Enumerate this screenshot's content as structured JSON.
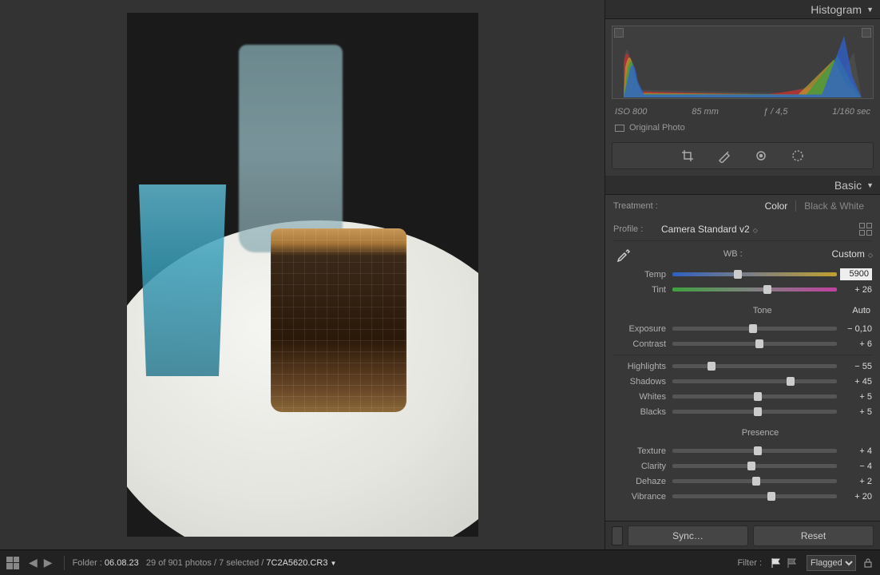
{
  "panels": {
    "histogram_title": "Histogram",
    "basic_title": "Basic"
  },
  "histogram": {
    "iso": "ISO 800",
    "focal": "85 mm",
    "aperture": "ƒ / 4,5",
    "shutter": "1/160 sec",
    "original_label": "Original Photo"
  },
  "treatment": {
    "label": "Treatment :",
    "color": "Color",
    "bw": "Black & White"
  },
  "profile": {
    "label": "Profile :",
    "value": "Camera Standard v2"
  },
  "wb": {
    "label": "WB :",
    "value": "Custom"
  },
  "sliders": {
    "temp": {
      "label": "Temp",
      "value": "5900",
      "pos": 40
    },
    "tint": {
      "label": "Tint",
      "value": "+ 26",
      "pos": 58
    },
    "exposure": {
      "label": "Exposure",
      "value": "− 0,10",
      "pos": 49
    },
    "contrast": {
      "label": "Contrast",
      "value": "+ 6",
      "pos": 53
    },
    "highlights": {
      "label": "Highlights",
      "value": "− 55",
      "pos": 24
    },
    "shadows": {
      "label": "Shadows",
      "value": "+ 45",
      "pos": 72
    },
    "whites": {
      "label": "Whites",
      "value": "+ 5",
      "pos": 52
    },
    "blacks": {
      "label": "Blacks",
      "value": "+ 5",
      "pos": 52
    },
    "texture": {
      "label": "Texture",
      "value": "+ 4",
      "pos": 52
    },
    "clarity": {
      "label": "Clarity",
      "value": "− 4",
      "pos": 48
    },
    "dehaze": {
      "label": "Dehaze",
      "value": "+ 2",
      "pos": 51
    },
    "vibrance": {
      "label": "Vibrance",
      "value": "+ 20",
      "pos": 60
    }
  },
  "headings": {
    "tone": "Tone",
    "auto": "Auto",
    "presence": "Presence"
  },
  "buttons": {
    "sync": "Sync…",
    "reset": "Reset"
  },
  "bottom": {
    "folder_label": "Folder :",
    "folder_value": "06.08.23",
    "count": "29 of 901 photos",
    "selected": "7 selected",
    "filename": "7C2A5620.CR3",
    "filter_label": "Filter :",
    "filter_value": "Flagged"
  }
}
